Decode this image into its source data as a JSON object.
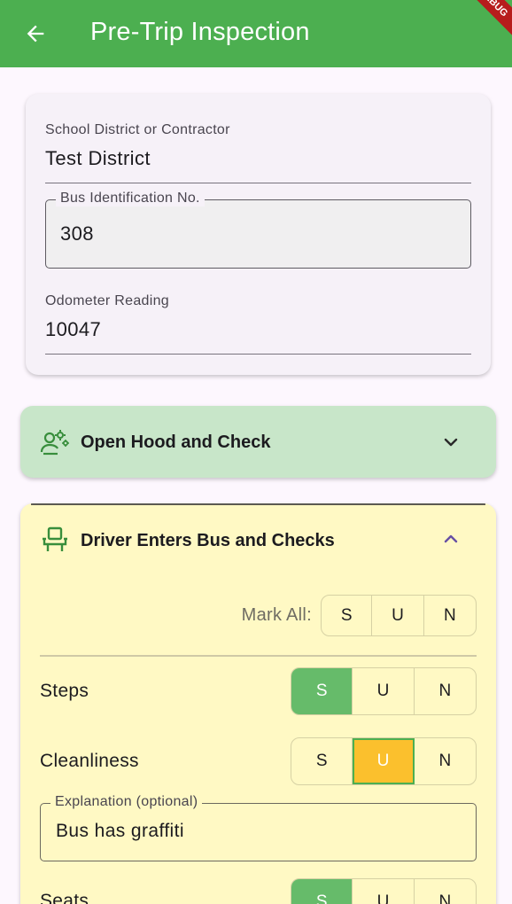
{
  "appbar": {
    "title": "Pre-Trip Inspection",
    "debug_banner": "DEBUG",
    "color": "#4caf50"
  },
  "form": {
    "district": {
      "label": "School District or Contractor",
      "value": "Test District"
    },
    "bus_id": {
      "label": "Bus Identification No.",
      "value": "308"
    },
    "odometer": {
      "label": "Odometer Reading",
      "value": "10047"
    }
  },
  "sections": {
    "hood": {
      "title": "Open Hood and Check",
      "icon": "mechanic-gears-icon",
      "expanded": false,
      "color": "#c8e6c9"
    },
    "driver": {
      "title": "Driver Enters Bus and Checks",
      "icon": "driver-seat-icon",
      "expanded": true,
      "color": "#fff9c4"
    }
  },
  "mark_all": {
    "label": "Mark All:",
    "options": [
      "S",
      "U",
      "N"
    ]
  },
  "items": [
    {
      "label": "Steps",
      "options": [
        "S",
        "U",
        "N"
      ],
      "selected": "S"
    },
    {
      "label": "Cleanliness",
      "options": [
        "S",
        "U",
        "N"
      ],
      "selected": "U",
      "explanation": {
        "label": "Explanation (optional)",
        "value": "Bus has graffiti"
      }
    },
    {
      "label": "Seats",
      "options": [
        "S",
        "U",
        "N"
      ],
      "selected": "S"
    }
  ],
  "colors": {
    "satisfactory": "#66bb6a",
    "unsatisfactory": "#fbc02d"
  }
}
